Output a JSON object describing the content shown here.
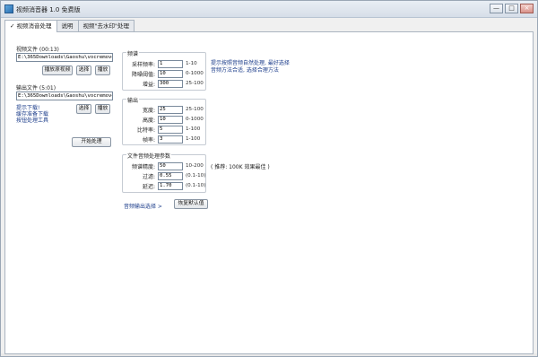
{
  "window": {
    "title": "视频消音器 1.0 免费版",
    "buttons": [
      "—",
      "□",
      "×"
    ]
  },
  "tabs": [
    {
      "label": "✓ 视频消音处理",
      "active": true
    },
    {
      "label": "说明",
      "active": false
    },
    {
      "label": "视频\"去水印\"处理",
      "active": false
    }
  ],
  "left": {
    "source_label": "视频文件  (00:13)",
    "source_path": "E:\\365Downloads\\Gaoshu\\vocremover\\视",
    "source_btn_preview": "播放原视频",
    "source_btn_select": "选择",
    "source_btn_play": "播放",
    "output_label": "输出文件  (5:01)",
    "output_path": "E:\\365Downloads\\Gaoshu\\vocremover\\视",
    "output_btn_select": "选择",
    "output_btn_play": "播放",
    "status_lines": [
      "提示下载!",
      "缓存准备下载",
      "按钮处理工具"
    ],
    "start_btn": "开始处理"
  },
  "groups": {
    "g1": {
      "legend": "频谱",
      "rows": [
        {
          "label": "采样频率:",
          "value": "1",
          "range": "1-10"
        },
        {
          "label": "降噪阈值:",
          "value": "10",
          "range": "0-1000"
        },
        {
          "label": "增益:",
          "value": "300",
          "range": "25-100"
        }
      ]
    },
    "g2": {
      "legend": "输出",
      "rows": [
        {
          "label": "宽度:",
          "value": "25",
          "range": "25-100"
        },
        {
          "label": "高度:",
          "value": "10",
          "range": "0-1000"
        },
        {
          "label": "比特率:",
          "value": "5",
          "range": "1-100"
        },
        {
          "label": "帧率:",
          "value": "3",
          "range": "1-100"
        }
      ]
    },
    "g3": {
      "legend": "文件音频处理参数",
      "rows": [
        {
          "label": "频谱精度:",
          "value": "50",
          "range": "10-200"
        },
        {
          "label": "过滤:",
          "value": "0.55",
          "range": "(0.1-10)"
        },
        {
          "label": "延迟:",
          "value": "1.70",
          "range": "(0.1-10)"
        }
      ]
    }
  },
  "notes": {
    "g1_note": [
      "提示按照音频自然处理, 最好选择",
      "音频方法合适, 选择合理方法"
    ],
    "g3_note": "( 推荐: 100K 效果最佳 )"
  },
  "bottom": {
    "link": "音频输出选择  >",
    "reset_btn": "恢复默认值"
  }
}
